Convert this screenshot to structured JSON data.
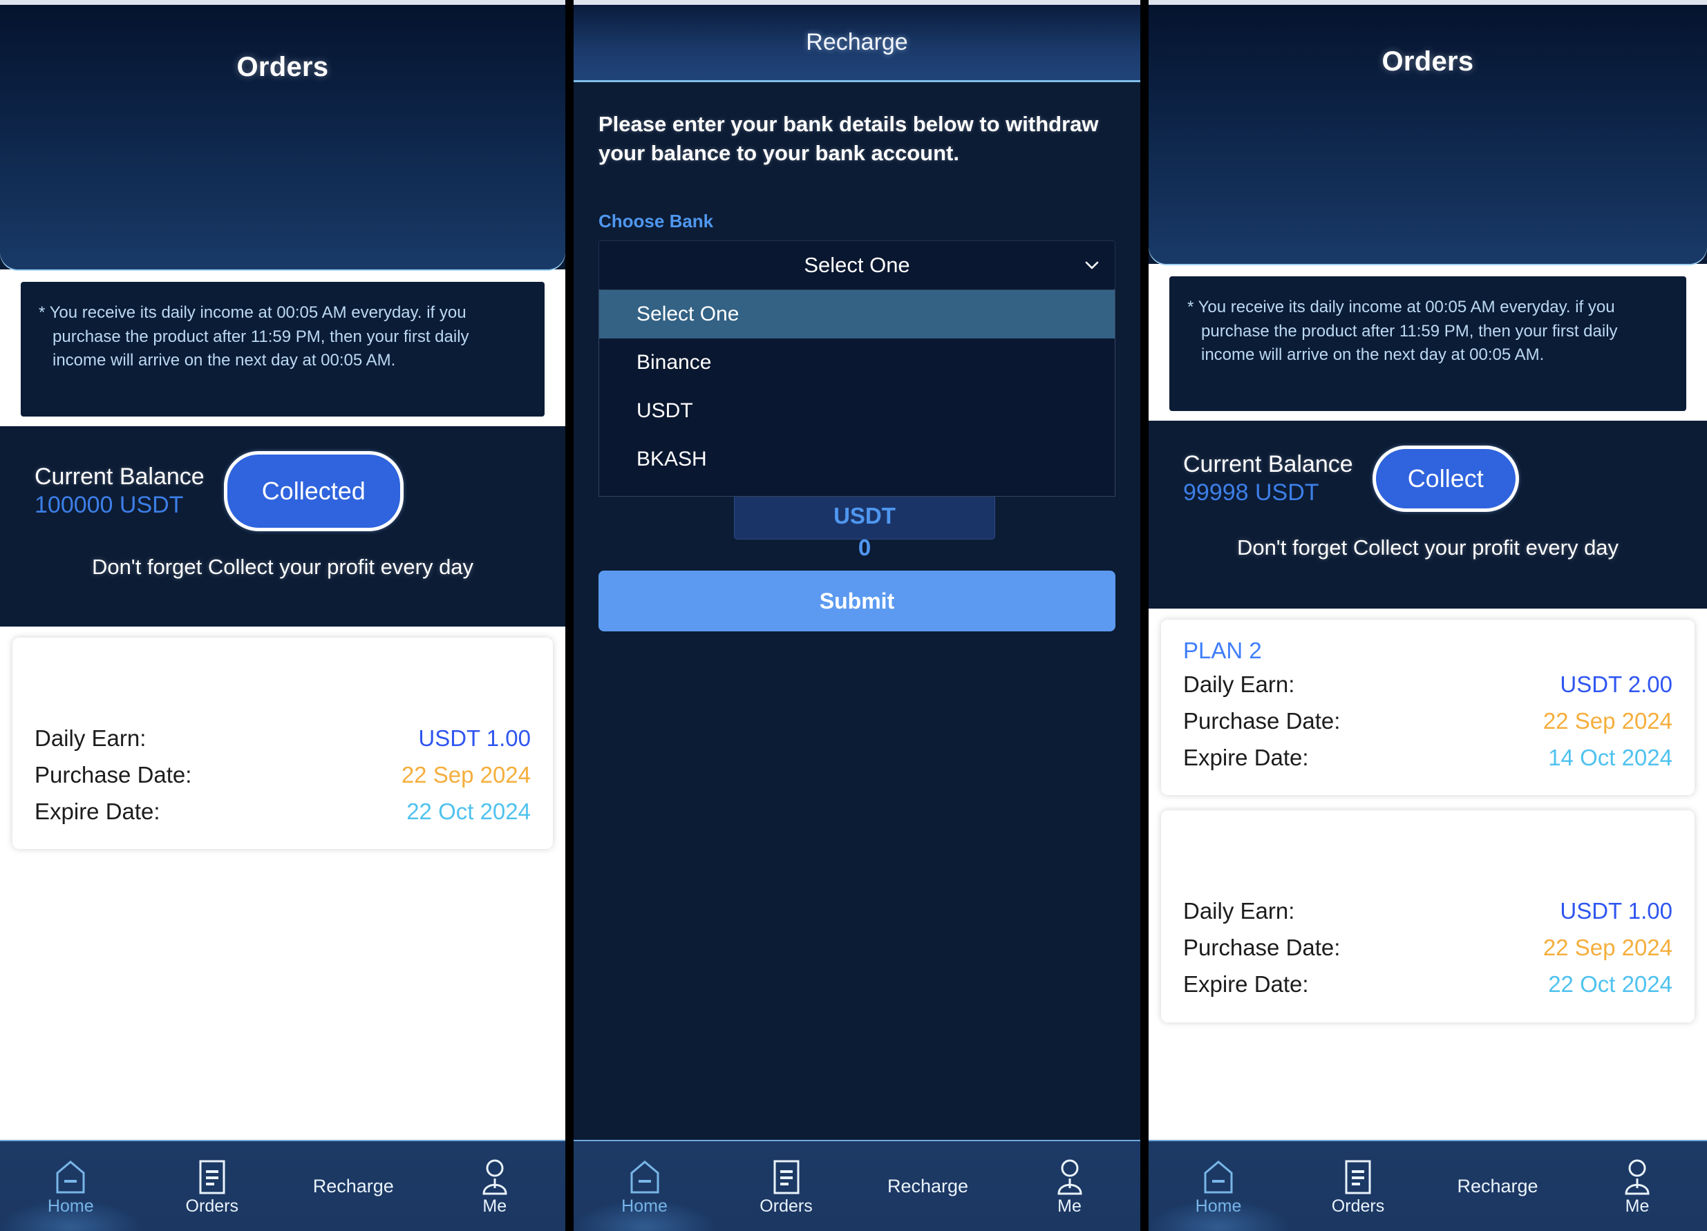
{
  "colors": {
    "accent_blue": "#2f64de",
    "link_blue": "#3f7dfb",
    "earn_blue": "#2f56f0",
    "purchase_amber": "#f5ae3c",
    "expire_cyan": "#4fc2ef",
    "header_gradient_top": "#05142e",
    "header_gradient_bottom": "#193a68",
    "panel_dark": "#0c1c35",
    "submit_blue": "#5b9af0",
    "dropdown_selected": "#336285"
  },
  "panel_orders_left": {
    "header": {
      "title": "Orders"
    },
    "notice": {
      "text": "* You receive its daily income at 00:05 AM everyday. if you purchase the product after 11:59 PM, then your first daily income will arrive on the next day at 00:05 AM."
    },
    "balance": {
      "label": "Current Balance",
      "amount": "100000 USDT",
      "button_label": "Collected",
      "tagline": "Don't forget Collect your profit every day"
    },
    "orders": [
      {
        "plan": "",
        "rows": [
          {
            "key": "Daily Earn:",
            "value": "USDT 1.00",
            "kind": "earn"
          },
          {
            "key": "Purchase Date:",
            "value": "22 Sep 2024",
            "kind": "purchase"
          },
          {
            "key": "Expire Date:",
            "value": "22 Oct 2024",
            "kind": "expire"
          }
        ]
      }
    ],
    "nav": [
      {
        "label": "Home",
        "icon": "home-icon",
        "active": true
      },
      {
        "label": "Orders",
        "icon": "orders-document-icon",
        "active": false
      },
      {
        "label": "Recharge",
        "icon": "none",
        "active": false
      },
      {
        "label": "Me",
        "icon": "person-icon",
        "active": false
      }
    ]
  },
  "panel_recharge_middle": {
    "header": {
      "title": "Recharge"
    },
    "lead_text": "Please enter your bank details below to withdraw your balance to your bank account.",
    "choose_bank_label": "Choose Bank",
    "select": {
      "value": "Select One",
      "open": true,
      "options": [
        "Select One",
        "Binance",
        "USDT",
        "BKASH"
      ],
      "selected_option": "Select One"
    },
    "amount_box": {
      "line1": "USDT",
      "line2": "0",
      "line3": "-",
      "line4": "USDT",
      "line5": "0"
    },
    "submit_label": "Submit",
    "nav": [
      {
        "label": "Home",
        "icon": "home-icon",
        "active": true
      },
      {
        "label": "Orders",
        "icon": "orders-document-icon",
        "active": false
      },
      {
        "label": "Recharge",
        "icon": "none",
        "active": false
      },
      {
        "label": "Me",
        "icon": "person-icon",
        "active": false
      }
    ]
  },
  "panel_orders_right": {
    "header": {
      "title": "Orders"
    },
    "notice": {
      "text": "* You receive its daily income at 00:05 AM everyday. if you purchase the product after 11:59 PM, then your first daily income will arrive on the next day at 00:05 AM."
    },
    "balance": {
      "label": "Current Balance",
      "amount": "99998 USDT",
      "button_label": "Collect",
      "tagline": "Don't forget Collect your profit every day"
    },
    "orders": [
      {
        "plan": "PLAN 2",
        "rows": [
          {
            "key": "Daily Earn:",
            "value": "USDT 2.00",
            "kind": "earn"
          },
          {
            "key": "Purchase Date:",
            "value": "22 Sep 2024",
            "kind": "purchase"
          },
          {
            "key": "Expire Date:",
            "value": "14 Oct 2024",
            "kind": "expire"
          }
        ]
      },
      {
        "plan": "",
        "rows": [
          {
            "key": "Daily Earn:",
            "value": "USDT 1.00",
            "kind": "earn"
          },
          {
            "key": "Purchase Date:",
            "value": "22 Sep 2024",
            "kind": "purchase"
          },
          {
            "key": "Expire Date:",
            "value": "22 Oct 2024",
            "kind": "expire"
          }
        ]
      }
    ],
    "nav": [
      {
        "label": "Home",
        "icon": "home-icon",
        "active": true
      },
      {
        "label": "Orders",
        "icon": "orders-document-icon",
        "active": false
      },
      {
        "label": "Recharge",
        "icon": "none",
        "active": false
      },
      {
        "label": "Me",
        "icon": "person-icon",
        "active": false
      }
    ]
  }
}
